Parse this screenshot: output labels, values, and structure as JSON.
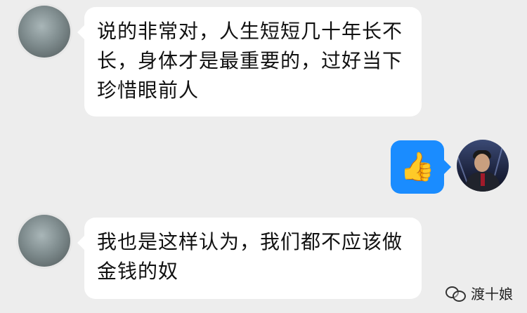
{
  "messages": [
    {
      "side": "left",
      "text": "说的非常对，人生短短几十年长不\n长，身体才是最重要的，过好当下\n珍惜眼前人"
    },
    {
      "side": "right",
      "emoji": "👍"
    },
    {
      "side": "left",
      "text": "我也是这样认为，我们都不应该做\n金钱的奴"
    }
  ],
  "watermark": {
    "text": "渡十娘",
    "icon": "wechat-bubbles-icon"
  },
  "colors": {
    "background": "#ededed",
    "bubble": "#ffffff",
    "blue_bubble": "#1a8cff"
  }
}
